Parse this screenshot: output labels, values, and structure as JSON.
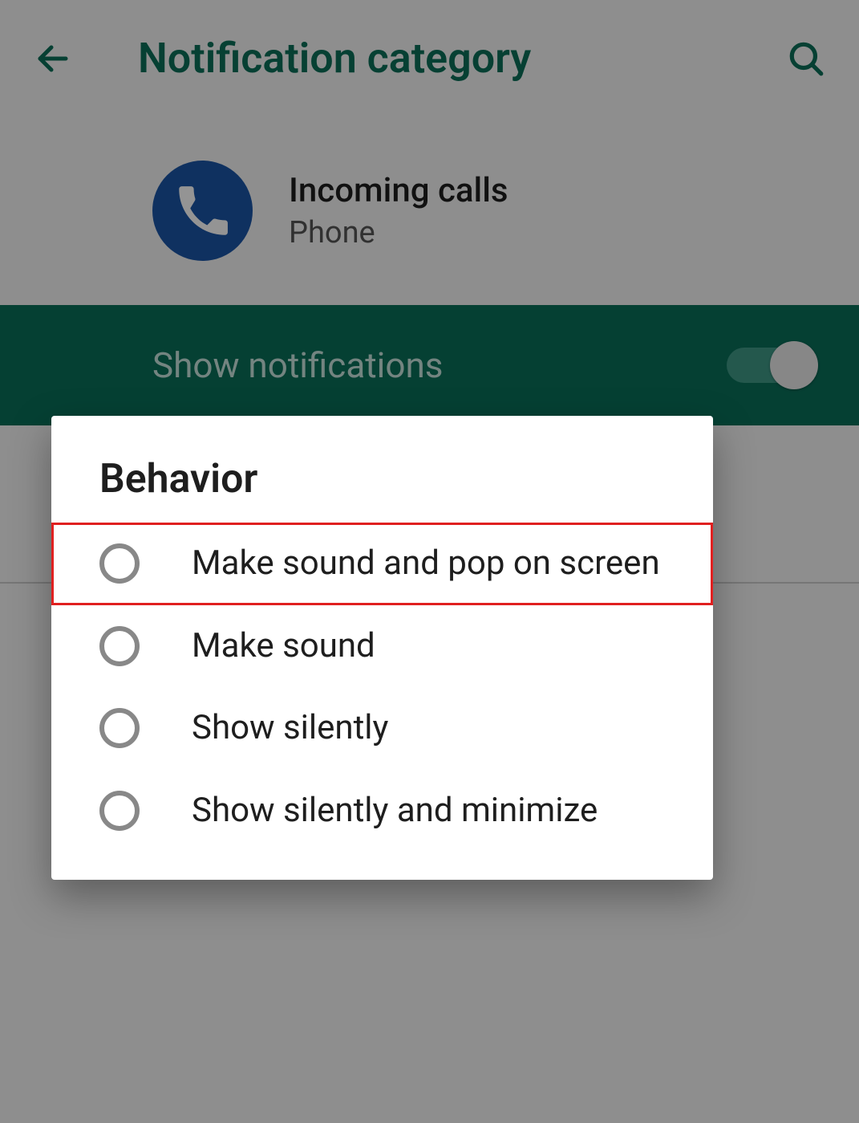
{
  "appbar": {
    "title": "Notification category"
  },
  "channel": {
    "title": "Incoming calls",
    "subtitle": "Phone"
  },
  "show_notifications": {
    "label": "Show notifications",
    "enabled": true
  },
  "dialog": {
    "title": "Behavior",
    "options": [
      {
        "label": "Make sound and pop on screen",
        "highlighted": true
      },
      {
        "label": "Make sound",
        "highlighted": false
      },
      {
        "label": "Show silently",
        "highlighted": false
      },
      {
        "label": "Show silently and minimize",
        "highlighted": false
      }
    ]
  },
  "icons": {
    "back": "back-arrow-icon",
    "search": "search-icon",
    "phone": "phone-icon"
  }
}
